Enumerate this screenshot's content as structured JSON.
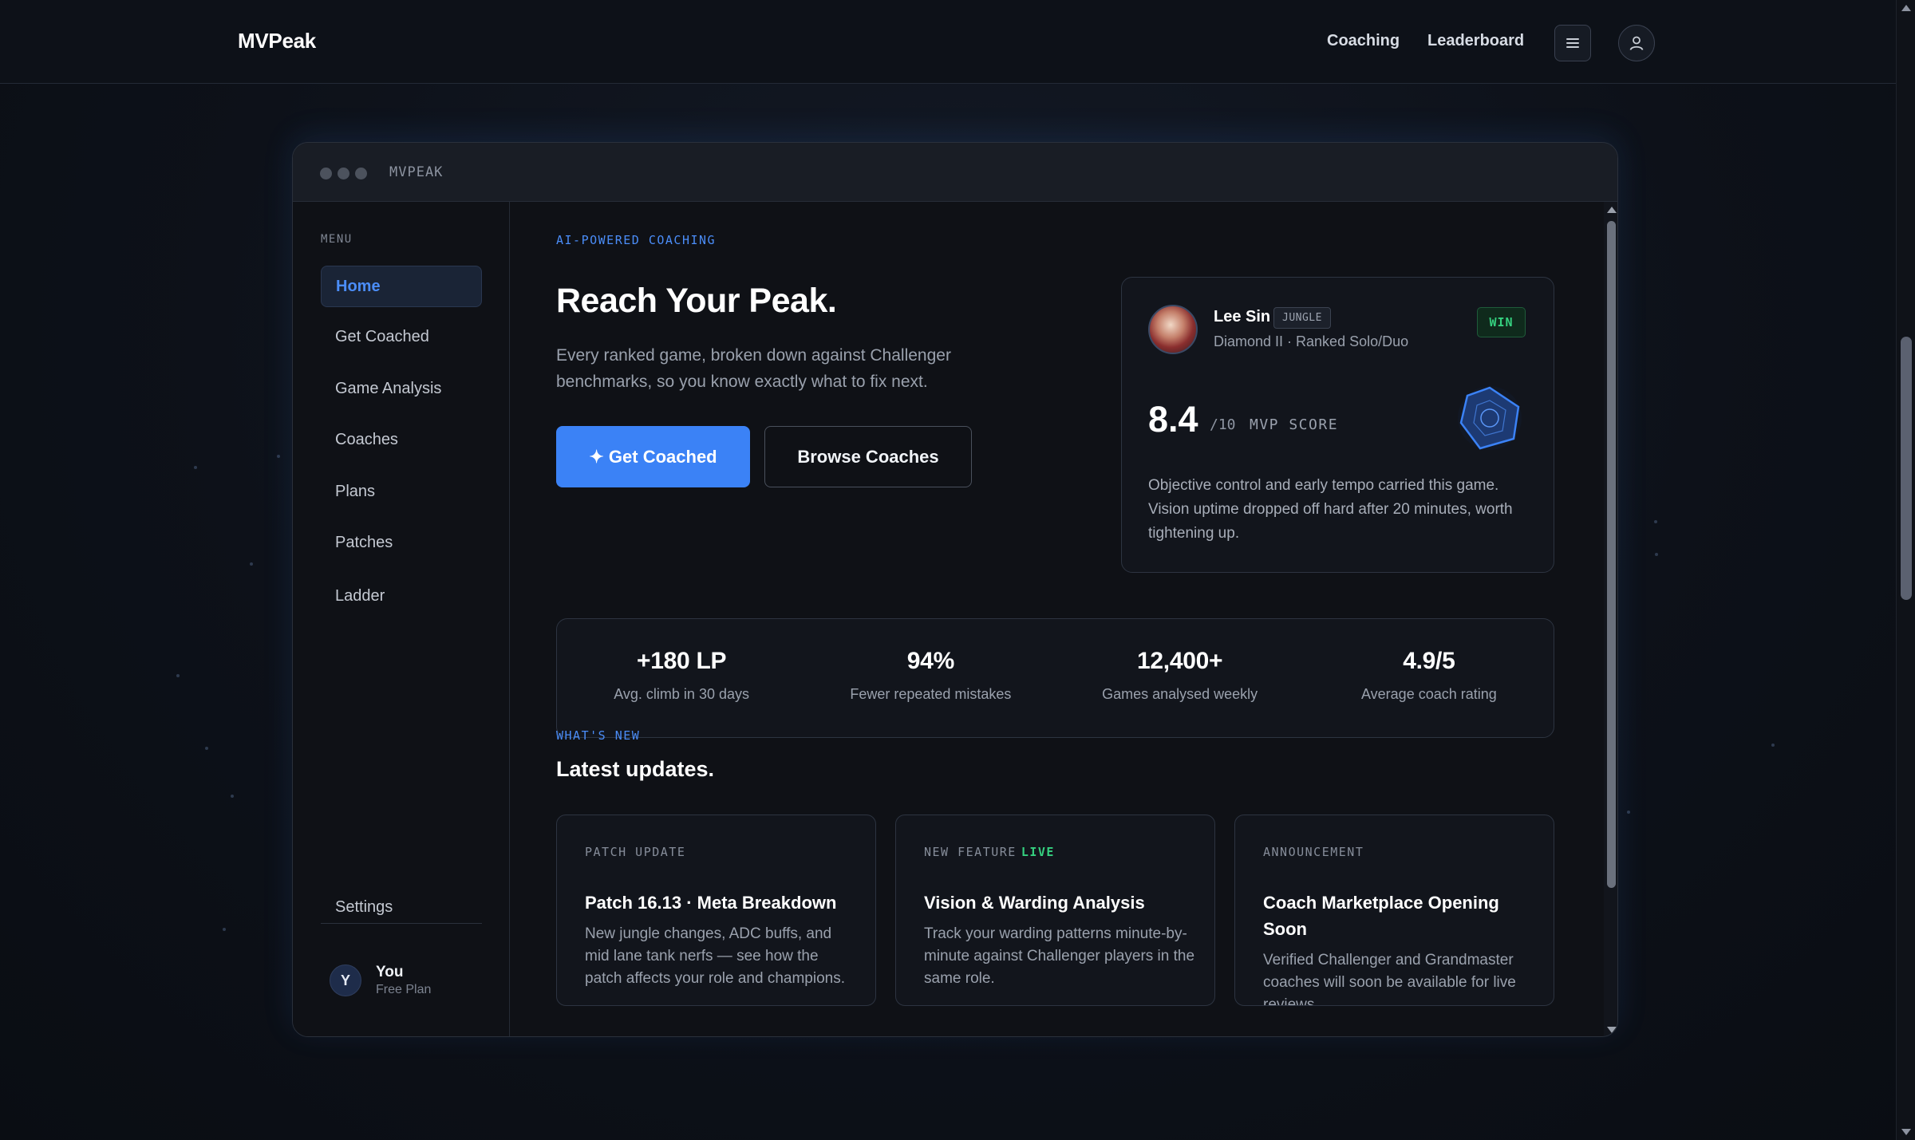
{
  "topnav": {
    "brand": "MVPeak",
    "links": [
      "Coaching",
      "Leaderboard"
    ],
    "menu_icon": "hamburger-icon",
    "user_icon": "user-icon"
  },
  "window": {
    "title": "MVPEAK"
  },
  "sidebar": {
    "menu_label": "MENU",
    "items": [
      {
        "label": "Home",
        "active": true
      },
      {
        "label": "Get Coached",
        "active": false
      },
      {
        "label": "Game Analysis",
        "active": false
      },
      {
        "label": "Coaches",
        "active": false
      },
      {
        "label": "Plans",
        "active": false
      },
      {
        "label": "Patches",
        "active": false
      },
      {
        "label": "Ladder",
        "active": false
      }
    ],
    "settings_label": "Settings",
    "user": {
      "initial": "Y",
      "name": "You",
      "plan": "Free Plan"
    }
  },
  "hero": {
    "eyebrow": "AI-POWERED COACHING",
    "title": "Reach Your Peak.",
    "subtitle": "Every ranked game, broken down against Challenger benchmarks, so you know exactly what to fix next.",
    "primary_button": "✦ Get Coached",
    "secondary_button": "Browse Coaches"
  },
  "game_card": {
    "champion": "Lee Sin",
    "role": "JUNGLE",
    "meta": "Diamond II · Ranked Solo/Duo",
    "result": "WIN",
    "score": "8.4",
    "score_denom": "/10",
    "score_label": "MVP SCORE",
    "description": "Objective control and early tempo carried this game. Vision uptime dropped off hard after 20 minutes, worth tightening up."
  },
  "stats": [
    {
      "value": "+180 LP",
      "label": "Avg. climb in 30 days"
    },
    {
      "value": "94%",
      "label": "Fewer repeated mistakes"
    },
    {
      "value": "12,400+",
      "label": "Games analysed weekly"
    },
    {
      "value": "4.9/5",
      "label": "Average coach rating"
    }
  ],
  "updates_section": {
    "eyebrow": "WHAT'S NEW",
    "title": "Latest updates.",
    "cards": [
      {
        "tag": "PATCH UPDATE",
        "live": "",
        "title": "Patch 16.13 · Meta Breakdown",
        "body": "New jungle changes, ADC buffs, and mid lane tank nerfs — see how the patch affects your role and champions."
      },
      {
        "tag": "NEW FEATURE",
        "live": "LIVE",
        "title": "Vision & Warding Analysis",
        "body": "Track your warding patterns minute-by-minute against Challenger players in the same role."
      },
      {
        "tag": "ANNOUNCEMENT",
        "live": "",
        "title": "Coach Marketplace Opening Soon",
        "body": "Verified Challenger and Grandmaster coaches will soon be available for live reviews."
      }
    ]
  },
  "colors": {
    "accent": "#3b82f6",
    "win": "#35d07f",
    "background": "#0d1119"
  }
}
